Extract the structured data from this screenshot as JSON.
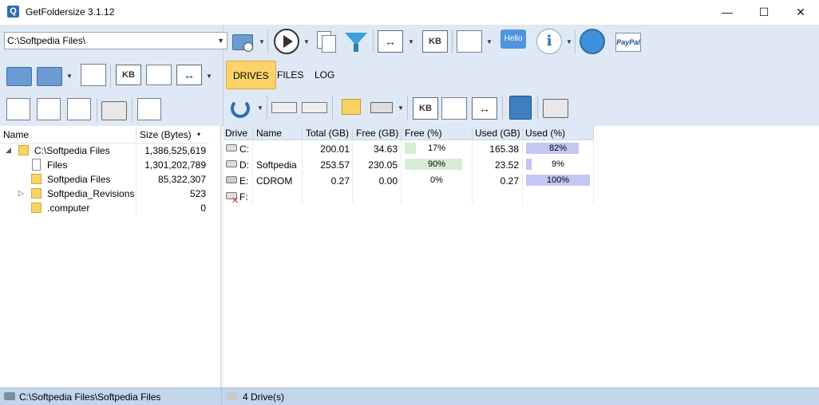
{
  "window": {
    "title": "GetFoldersize 3.1.12",
    "app_icon_glyph": "Q",
    "minimize_glyph": "—",
    "maximize_glyph": "☐",
    "close_glyph": "✕"
  },
  "path_combo": {
    "value": "C:\\Softpedia Files\\",
    "arrow": "▼"
  },
  "toolbar": {
    "kb_label": "KB",
    "hello_label": "Hello",
    "info_glyph": "i",
    "paypal_label": "PayPal",
    "drop_glyph": "▼",
    "swap_glyph": "↔"
  },
  "tabs": [
    {
      "label": "DRIVES",
      "active": true
    },
    {
      "label": "FILES",
      "active": false
    },
    {
      "label": "LOG",
      "active": false
    }
  ],
  "tree": {
    "col_name": "Name",
    "col_size": "Size (Bytes)",
    "sort_glyph": "▾",
    "rows": [
      {
        "name": "C:\\Softpedia Files",
        "size": "1,386,525,619",
        "expander": "◢",
        "type": "folder"
      },
      {
        "name": "Files",
        "size": "1,301,202,789",
        "expander": "",
        "type": "file"
      },
      {
        "name": "Softpedia Files",
        "size": "85,322,307",
        "expander": "",
        "type": "folder"
      },
      {
        "name": "Softpedia_Revisions",
        "size": "523",
        "expander": "▷",
        "type": "folder"
      },
      {
        "name": ".computer",
        "size": "0",
        "expander": "",
        "type": "folder"
      }
    ]
  },
  "drives_grid": {
    "columns": [
      "Drive",
      "Name",
      "Total (GB)",
      "Free (GB)",
      "Free (%)",
      "Used (GB)",
      "Used (%)"
    ],
    "rows": [
      {
        "drive": "C:",
        "name": "",
        "total": "200.01",
        "free": "34.63",
        "free_pct": "17%",
        "free_frac": 0.17,
        "used": "165.38",
        "used_pct": "82%",
        "used_frac": 0.82,
        "status": "ok"
      },
      {
        "drive": "D:",
        "name": "Softpedia",
        "total": "253.57",
        "free": "230.05",
        "free_pct": "90%",
        "free_frac": 0.9,
        "used": "23.52",
        "used_pct": "9%",
        "used_frac": 0.09,
        "status": "ok"
      },
      {
        "drive": "E:",
        "name": "CDROM",
        "total": "0.27",
        "free": "0.00",
        "free_pct": "0%",
        "free_frac": 0.0,
        "used": "0.27",
        "used_pct": "100%",
        "used_frac": 1.0,
        "status": "cd"
      },
      {
        "drive": "F:",
        "name": "",
        "total": "",
        "free": "",
        "free_pct": "",
        "free_frac": 0.0,
        "used": "",
        "used_pct": "",
        "used_frac": 0.0,
        "status": "error"
      }
    ]
  },
  "status": {
    "left": "C:\\Softpedia Files\\Softpedia Files",
    "right": "4 Drive(s)"
  },
  "colors": {
    "accent_tab": "#fbd36a",
    "free_bar": "#d7ecd5",
    "used_bar": "#c4c6f4",
    "toolbar_bg": "#dfe9f5",
    "status_bg": "#c3d5ea"
  }
}
